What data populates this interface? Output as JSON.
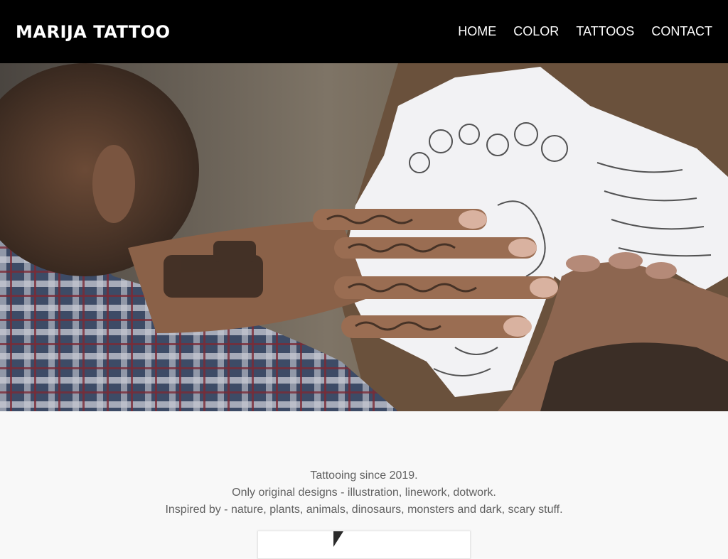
{
  "header": {
    "brand": "MARIJA TATTOO",
    "nav": [
      {
        "label": "HOME"
      },
      {
        "label": "COLOR"
      },
      {
        "label": "TATTOOS"
      },
      {
        "label": "CONTACT"
      }
    ]
  },
  "hero": {
    "image": "tattoo-artist-hands-on-stencil-photo"
  },
  "intro": {
    "lines": [
      "Tattooing since 2019.",
      "Only original designs - illustration, linework, dotwork.",
      "Inspired by - nature, plants, animals, dinosaurs, monsters and dark, scary stuff."
    ]
  },
  "colors": {
    "header_bg": "#000000",
    "page_bg": "#f8f8f8",
    "text": "#616161"
  }
}
